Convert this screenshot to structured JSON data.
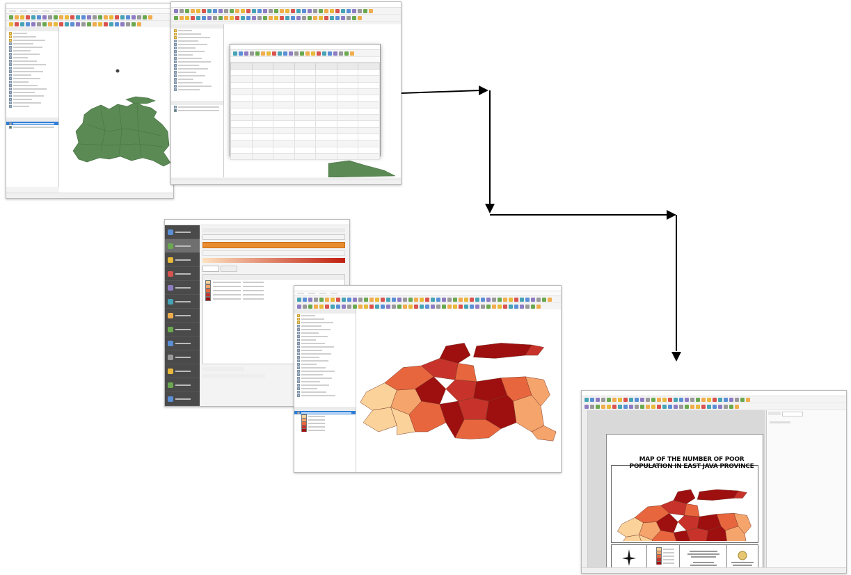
{
  "layout_title": "MAP OF THE NUMBER OF POOR POPULATION IN EAST JAVA PROVINCE",
  "colors": {
    "green_fill": "#5b8a55",
    "green_stroke": "#3e6a3a",
    "class_1": "#fbd29a",
    "class_2": "#f5a46c",
    "class_3": "#e8663e",
    "class_4": "#c7332a",
    "class_5": "#9e0f10",
    "ramp_start": "#fde2c0",
    "ramp_end": "#c11f0f",
    "arrow": "#000000",
    "selection_blue": "#2f7fd6"
  },
  "icons": [
    "arrow-right-icon",
    "arrow-down-icon",
    "layer-icon",
    "folder-icon",
    "compass-rose-icon",
    "logo-seal-icon",
    "map-pan-icon",
    "zoom-icon",
    "save-icon"
  ]
}
